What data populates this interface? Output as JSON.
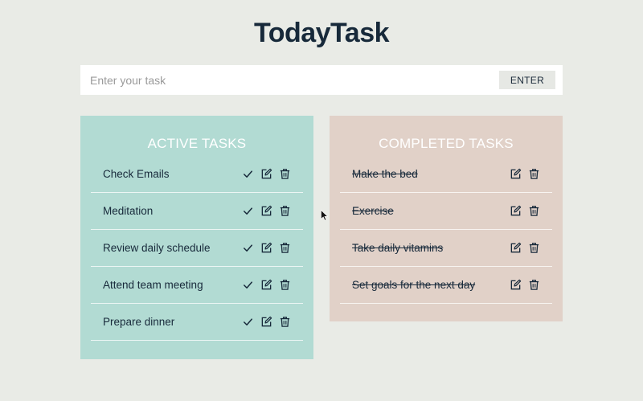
{
  "app": {
    "title": "TodayTask"
  },
  "input": {
    "placeholder": "Enter your task",
    "value": "",
    "enter_label": "ENTER"
  },
  "active": {
    "title": "ACTIVE TASKS",
    "items": [
      {
        "label": "Check Emails"
      },
      {
        "label": "Meditation"
      },
      {
        "label": "Review daily schedule"
      },
      {
        "label": "Attend team meeting"
      },
      {
        "label": "Prepare dinner"
      }
    ]
  },
  "completed": {
    "title": "COMPLETED TASKS",
    "items": [
      {
        "label": "Make the bed"
      },
      {
        "label": "Exercise"
      },
      {
        "label": "Take daily vitamins"
      },
      {
        "label": "Set goals for the next day"
      }
    ]
  },
  "colors": {
    "background": "#e9ebe6",
    "active_panel": "#b2dbd3",
    "completed_panel": "#e1d1c8",
    "text": "#17293a"
  },
  "icons": {
    "complete": "check-icon",
    "edit": "edit-icon",
    "delete": "trash-icon"
  }
}
